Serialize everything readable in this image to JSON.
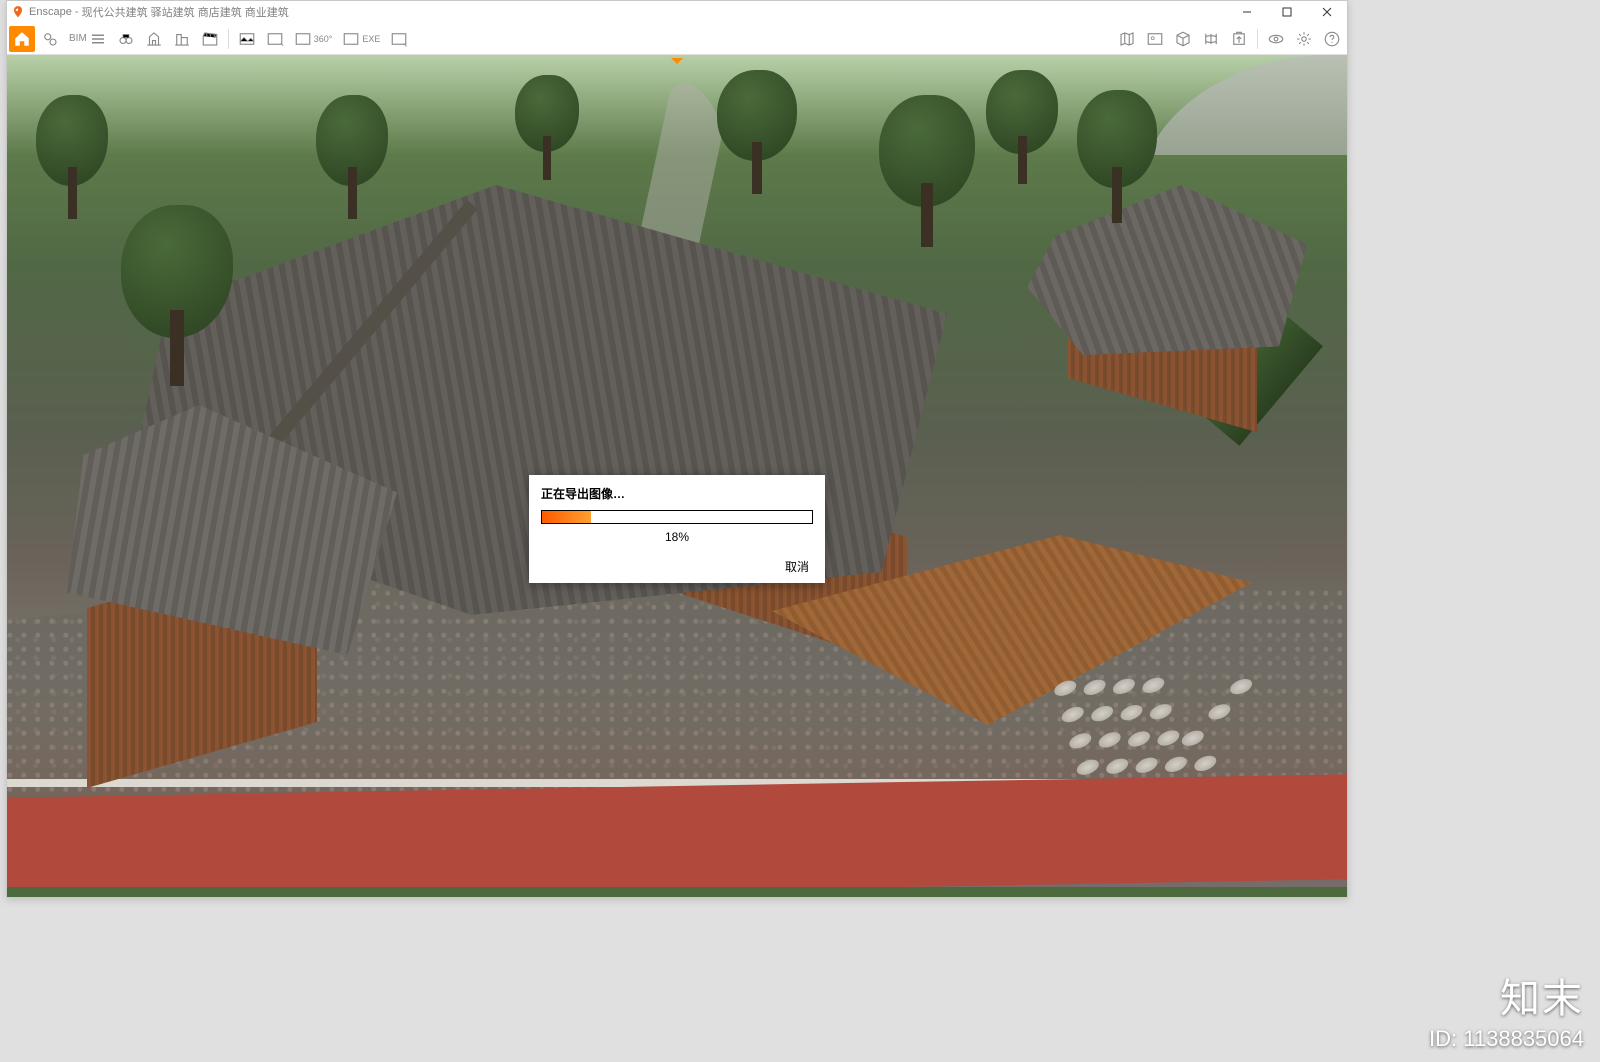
{
  "app": {
    "name": "Enscape",
    "title_suffix": "现代公共建筑 驿站建筑 商店建筑 商业建筑"
  },
  "window_controls": {
    "minimize": "minimize",
    "maximize": "maximize",
    "close": "close"
  },
  "toolbar": {
    "bim_label": "BIM",
    "pano_label": "360°",
    "exe_label": "EXE",
    "items_left": [
      {
        "name": "home-icon",
        "active": true
      },
      {
        "name": "pin-location-icon"
      },
      {
        "name": "bim-menu",
        "label": "BIM"
      },
      {
        "name": "binoculars-icon"
      },
      {
        "name": "layers-icon"
      },
      {
        "name": "buildings-icon"
      },
      {
        "name": "clapper-icon"
      },
      {
        "name": "sep"
      },
      {
        "name": "screenshot-icon"
      },
      {
        "name": "screenshot-settings-icon"
      },
      {
        "name": "panorama-icon",
        "label": "360°"
      },
      {
        "name": "export-exe-icon",
        "label": "EXE"
      },
      {
        "name": "export-exe-arrow-icon"
      }
    ],
    "items_right": [
      {
        "name": "map-icon"
      },
      {
        "name": "asset-library-icon"
      },
      {
        "name": "cube-arrow-icon"
      },
      {
        "name": "panorama-gallery-icon"
      },
      {
        "name": "upload-icon"
      },
      {
        "name": "sep"
      },
      {
        "name": "eye-visual-settings-icon"
      },
      {
        "name": "gear-settings-icon"
      },
      {
        "name": "help-icon"
      }
    ]
  },
  "dialog": {
    "title": "正在导出图像…",
    "progress_percent": 18,
    "percent_label": "18%",
    "cancel_label": "取消"
  },
  "watermark": {
    "brand": "知末",
    "id_label": "ID: 1138835064"
  },
  "colors": {
    "accent": "#ff8a00",
    "progress_start": "#ff5a00",
    "progress_end": "#ffa030"
  }
}
